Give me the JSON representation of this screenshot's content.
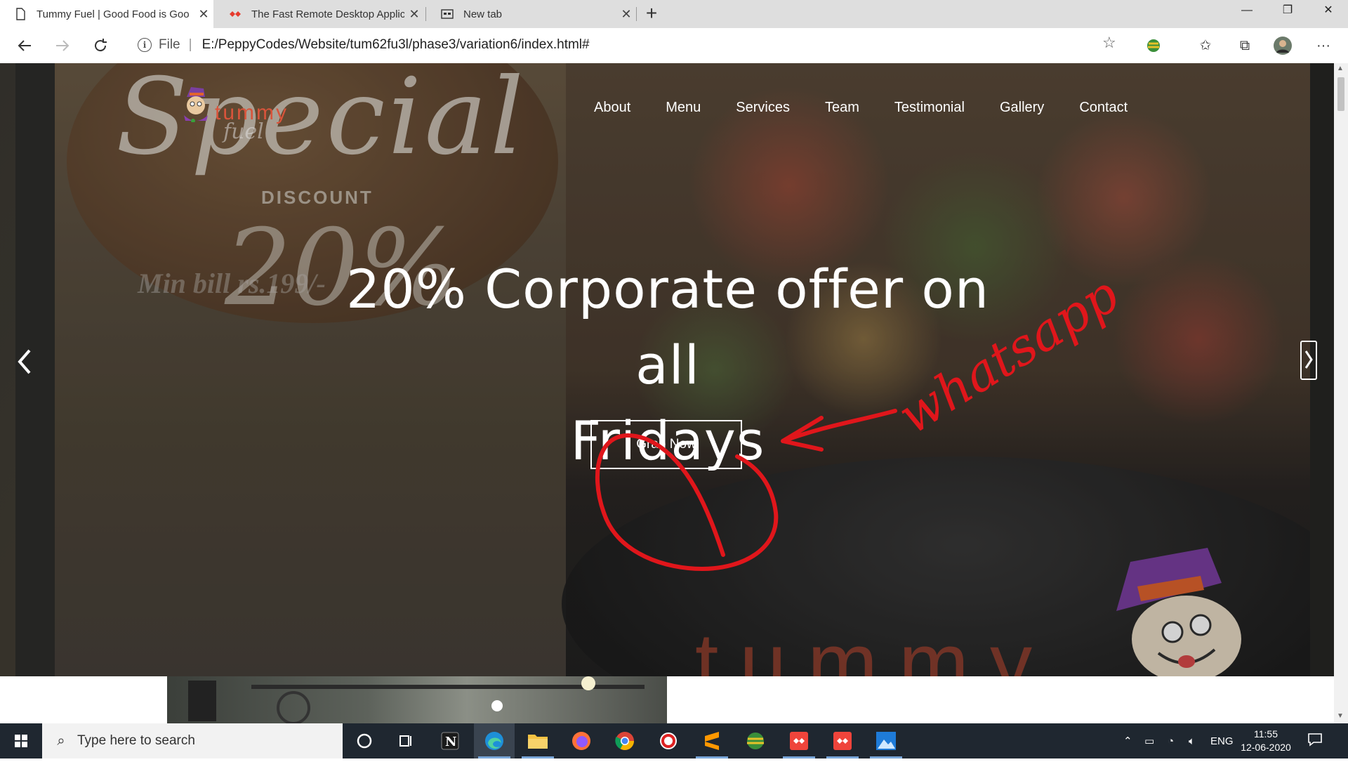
{
  "browser": {
    "tabs": [
      {
        "title": "Tummy Fuel | Good Food is Goo",
        "icon": "page-icon",
        "active": true
      },
      {
        "title": "The Fast Remote Desktop Applic",
        "icon": "anydesk-icon",
        "active": false
      },
      {
        "title": "New tab",
        "icon": "newtab-icon",
        "active": false
      }
    ],
    "close_glyph": "✕",
    "new_tab_glyph": "+",
    "window_controls": {
      "minimize": "—",
      "maximize": "❐",
      "close": "✕"
    },
    "address": {
      "scheme": "File",
      "separator": "|",
      "url": "E:/PeppyCodes/Website/tum62fu3l/phase3/variation6/index.html#"
    }
  },
  "site": {
    "logo_text": "tummy",
    "logo_sub": "fuel",
    "nav": [
      "About",
      "Menu",
      "Services",
      "Team",
      "Testimonial",
      "Gallery",
      "Contact"
    ],
    "hero": {
      "title_line1": "20% Corporate offer on all",
      "title_line2": "Fridays",
      "button": "Grab Now"
    },
    "promo": {
      "special": "Special",
      "discount": "DISCOUNT",
      "percent": "20%",
      "min_bill": "Min bill rs.199/-"
    },
    "brand_watermark": "tummy",
    "annotation_text": "whatsapp",
    "annotation_color": "#e0161b"
  },
  "taskbar": {
    "search_placeholder": "Type here to search",
    "apps": [
      "cortana-icon",
      "task-view-icon",
      "notion-icon",
      "edge-icon",
      "file-explorer-icon",
      "firefox-icon",
      "chrome-icon",
      "app-icon",
      "sublime-icon",
      "earth-icon",
      "anydesk-icon",
      "anydesk-icon",
      "photos-icon"
    ],
    "lang": "ENG",
    "time": "11:55",
    "date": "12-06-2020"
  }
}
